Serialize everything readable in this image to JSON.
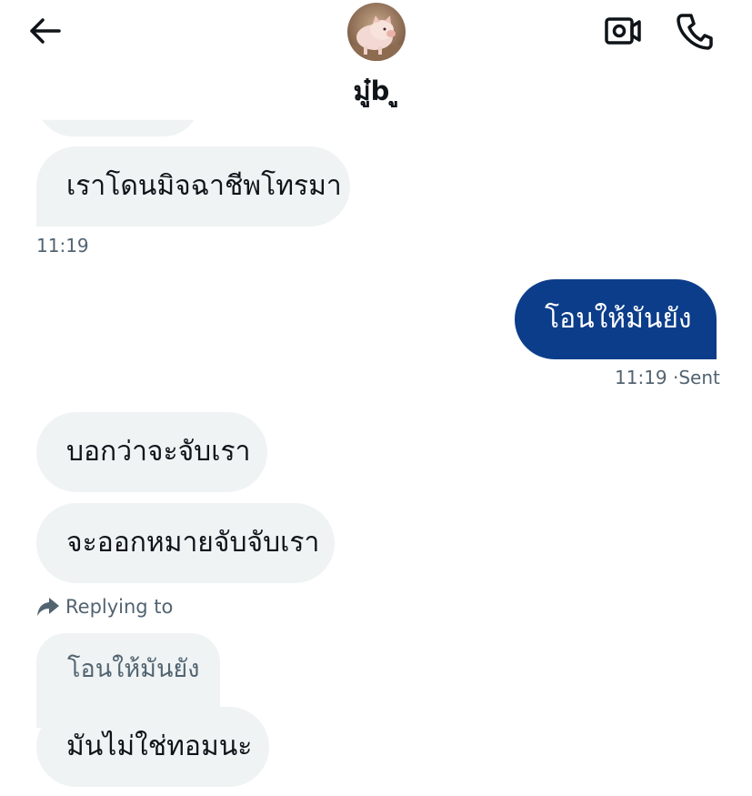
{
  "header": {
    "back_icon": "arrow-left-icon",
    "contact_name": "มู๋b ู",
    "video_icon": "video-camera-icon",
    "phone_icon": "phone-icon"
  },
  "messages": [
    {
      "text": "เราโดนมิจฉาชีพโทรมา",
      "direction": "received"
    },
    {
      "time": "11:19"
    },
    {
      "text": "โอนให้มันยัง",
      "direction": "sent"
    },
    {
      "time": "11:19",
      "status": "Sent"
    },
    {
      "text": "บอกว่าจะจับเรา",
      "direction": "received"
    },
    {
      "text": "จะออกหมายจับจับเรา",
      "direction": "received"
    },
    {
      "replying_label": "Replying to",
      "quoted": "โอนให้มันยัง"
    },
    {
      "text": "มันไม่ใช่ทอมนะ",
      "direction": "received"
    }
  ],
  "colors": {
    "sent_bubble": "#0c3d8a",
    "received_bubble": "#eff3f4",
    "muted_text": "#536471"
  }
}
